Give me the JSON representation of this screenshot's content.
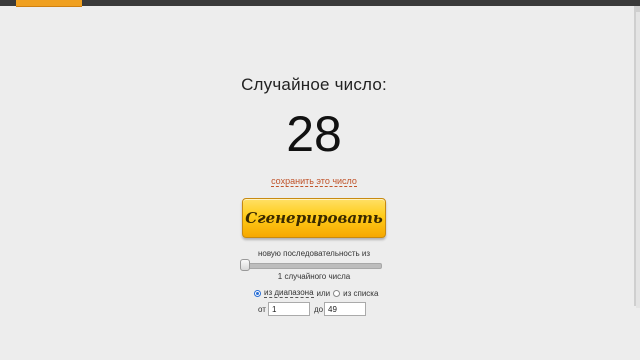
{
  "result": {
    "heading": "Случайное число:",
    "value": "28",
    "save_link": "сохранить это число"
  },
  "controls": {
    "generate_button": "Сгенерировать",
    "sequence_label": "новую последовательность из",
    "count_label": "1 случайного числа",
    "slider_value": 1,
    "mode": {
      "range_label": "из диапазона",
      "or_label": "или",
      "list_label": "из списка",
      "selected": "range"
    },
    "range": {
      "from_label": "от",
      "from_value": "1",
      "to_label": "до",
      "to_value": "49"
    }
  },
  "colors": {
    "accent": "#f0a020",
    "button": "#ffcc1a",
    "link": "#c0532a",
    "topbar": "#3a3a3a",
    "background": "#ededed"
  }
}
